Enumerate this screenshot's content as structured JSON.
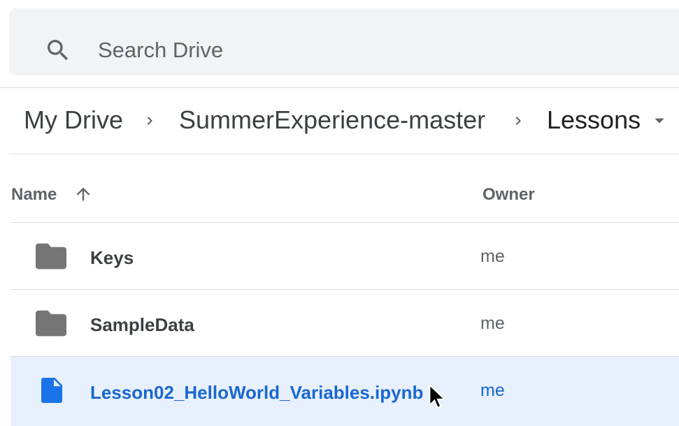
{
  "search": {
    "placeholder": "Search Drive",
    "icon": "search-icon"
  },
  "breadcrumb": {
    "items": [
      "My Drive",
      "SummerExperience-master",
      "Lessons"
    ],
    "separator_icon": "chevron-right-icon",
    "dropdown_icon": "caret-down-icon"
  },
  "columns": {
    "name": "Name",
    "sort_icon": "arrow-up-icon",
    "owner": "Owner"
  },
  "files": [
    {
      "name": "Keys",
      "owner": "me",
      "icon": "folder-icon",
      "selected": false
    },
    {
      "name": "SampleData",
      "owner": "me",
      "icon": "folder-icon",
      "selected": false
    },
    {
      "name": "Lesson02_HelloWorld_Variables.ipynb",
      "owner": "me",
      "icon": "file-icon",
      "selected": true
    }
  ],
  "colors": {
    "folder": "#757575",
    "selected_bg": "#e8f0fe",
    "selected_text": "#1967d2",
    "file_icon": "#1a73e8"
  }
}
